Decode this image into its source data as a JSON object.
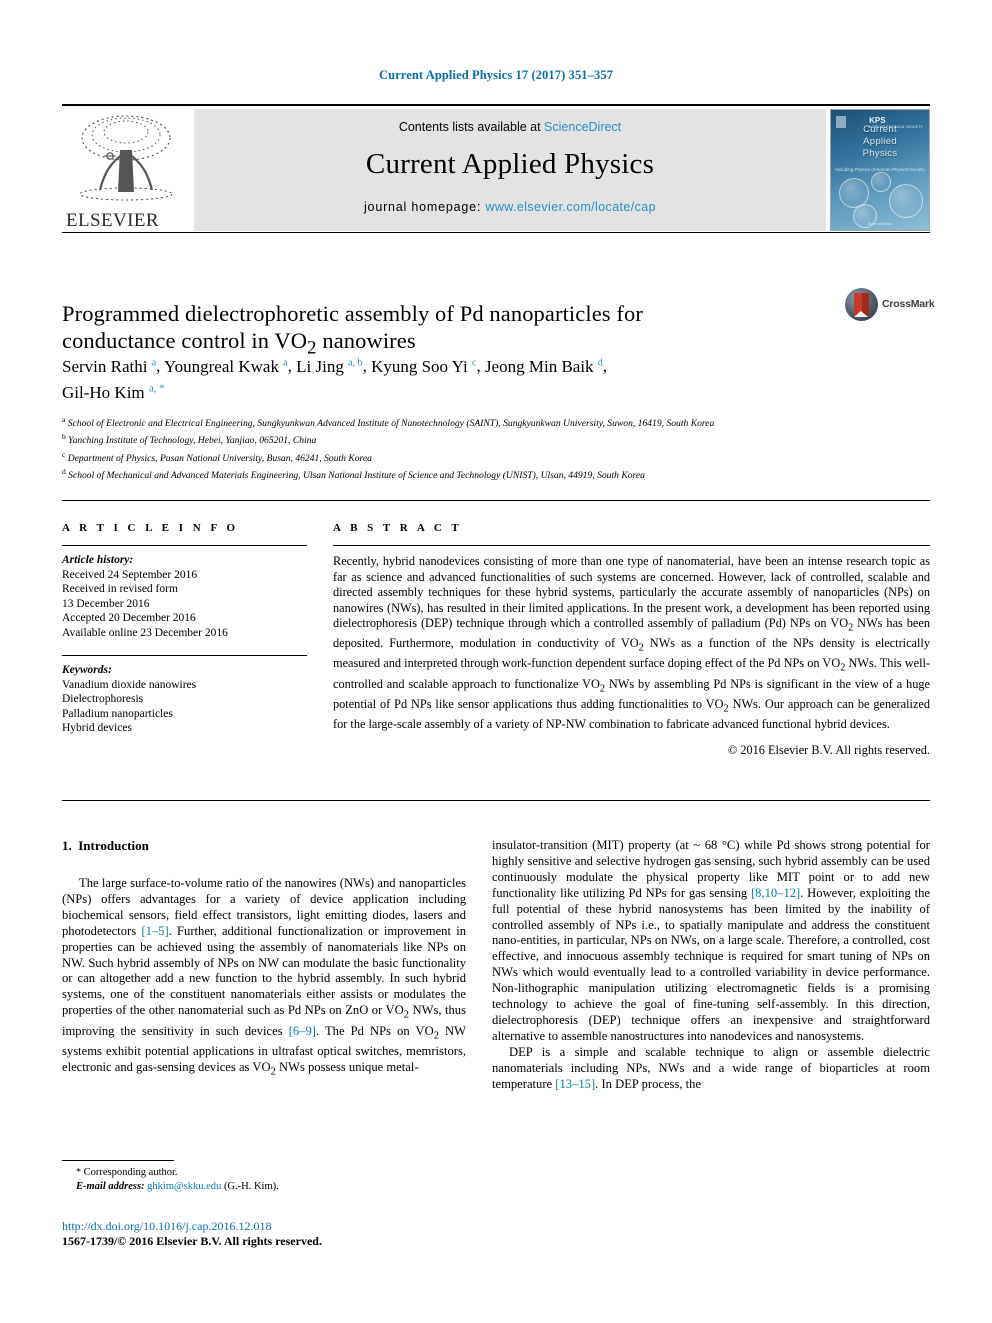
{
  "running_head": "Current Applied Physics 17 (2017) 351–357",
  "masthead": {
    "publisher_name": "ELSEVIER",
    "contents_prefix": "Contents lists available at ",
    "contents_link": "ScienceDirect",
    "journal_name": "Current Applied Physics",
    "homepage_label": "journal homepage: ",
    "homepage_url": "www.elsevier.com/locate/cap",
    "cover": {
      "line1": "Current",
      "line2": "Applied",
      "line3": "Physics",
      "subtitle": "Including Physics of Korean Physical Society",
      "society": "KPS",
      "society_sub": "KOREAN PHYSICAL SOCIETY",
      "footer": "ScienceDirect"
    }
  },
  "article": {
    "title_line1": "Programmed dielectrophoretic assembly of Pd nanoparticles for",
    "title_line2_a": "conductance control in VO",
    "title_line2_sub": "2",
    "title_line2_b": " nanowires",
    "crossmark_label": "CrossMark",
    "authors": [
      {
        "name": "Servin Rathi",
        "marks": "a",
        "sep": ", "
      },
      {
        "name": "Youngreal Kwak",
        "marks": "a",
        "sep": ", "
      },
      {
        "name": "Li Jing",
        "marks": "a, b",
        "sep": ", "
      },
      {
        "name": "Kyung Soo Yi",
        "marks": "c",
        "sep": ", "
      },
      {
        "name": "Jeong Min Baik",
        "marks": "d",
        "sep": ","
      },
      {
        "name": "Gil-Ho Kim",
        "marks": "a, *",
        "sep": ""
      }
    ],
    "affiliations": [
      {
        "mark": "a",
        "text": "School of Electronic and Electrical Engineering, Sungkyunkwan Advanced Institute of Nanotechnology (SAINT), Sungkyunkwan University, Suwon, 16419, South Korea"
      },
      {
        "mark": "b",
        "text": "Yanching Institute of Technology, Hebei, Yanjiao, 065201, China"
      },
      {
        "mark": "c",
        "text": "Department of Physics, Pusan National University, Busan, 46241, South Korea"
      },
      {
        "mark": "d",
        "text": "School of Mechanical and Advanced Materials Engineering, Ulsan National Institute of Science and Technology (UNIST), Ulsan, 44919, South Korea"
      }
    ]
  },
  "article_info": {
    "heading": "A R T I C L E   I N F O",
    "history_label": "Article history:",
    "history": [
      "Received 24 September 2016",
      "Received in revised form",
      "13 December 2016",
      "Accepted 20 December 2016",
      "Available online 23 December 2016"
    ],
    "keywords_label": "Keywords:",
    "keywords": [
      "Vanadium dioxide nanowires",
      "Dielectrophoresis",
      "Palladium nanoparticles",
      "Hybrid devices"
    ]
  },
  "abstract": {
    "heading": "A B S T R A C T",
    "p1": "Recently, hybrid nanodevices consisting of more than one type of nanomaterial, have been an intense research topic as far as science and advanced functionalities of such systems are concerned. However, lack of controlled, scalable and directed assembly techniques for these hybrid systems, particularly the accurate assembly of nanoparticles (NPs) on nanowires (NWs), has resulted in their limited applications. In the present work, a development has been reported using dielectrophoresis (DEP) technique through which a controlled assembly of palladium (Pd) NPs on VO",
    "p1_sub1": "2",
    "p1b": " NWs has been deposited. Furthermore, modulation in conductivity of VO",
    "p1_sub2": "2",
    "p1c": " NWs as a function of the NPs density is electrically measured and interpreted through work-function dependent surface doping effect of the Pd NPs on VO",
    "p1_sub3": "2",
    "p1d": " NWs. This well-controlled and scalable approach to functionalize VO",
    "p1_sub4": "2",
    "p1e": " NWs by assembling Pd NPs is significant in the view of a huge potential of Pd NPs like sensor applications thus adding functionalities to VO",
    "p1_sub5": "2",
    "p1f": " NWs. Our approach can be generalized for the large-scale assembly of a variety of NP-NW combination to fabricate advanced functional hybrid devices.",
    "copyright": "© 2016 Elsevier B.V. All rights reserved."
  },
  "body": {
    "section_number": "1.",
    "section_title": "Introduction",
    "left": {
      "p1_a": "The large surface-to-volume ratio of the nanowires (NWs) and nanoparticles (NPs) offers advantages for a variety of device application including biochemical sensors, field effect transistors, light emitting diodes, lasers and photodetectors ",
      "p1_ref1": "[1–5]",
      "p1_b": ". Further, additional functionalization or improvement in properties can be achieved using the assembly of nanomaterials like NPs on NW. Such hybrid assembly of NPs on NW can modulate the basic functionality or can altogether add a new function to the hybrid assembly. In such hybrid systems, one of the constituent nanomaterials either assists or modulates the properties of the other nanomaterial such as Pd NPs on ZnO or VO",
      "p1_sub1": "2",
      "p1_c": " NWs, thus improving the sensitivity in such devices ",
      "p1_ref2": "[6–9]",
      "p1_d": ". The Pd NPs on VO",
      "p1_sub2": "2",
      "p1_e": " NW systems exhibit potential applications in ultrafast optical switches, memristors, electronic and gas-sensing devices as VO",
      "p1_sub3": "2",
      "p1_f": " NWs possess unique metal-"
    },
    "right": {
      "p1_a": "insulator-transition (MIT) property (at ~ 68 °C) while Pd shows strong potential for highly sensitive and selective hydrogen gas sensing, such hybrid assembly can be used continuously modulate the physical property like MIT point or to add new functionality like utilizing Pd NPs for gas sensing ",
      "p1_ref1": "[8,10–12]",
      "p1_b": ". However, exploiting the full potential of these hybrid nanosystems has been limited by the inability of controlled assembly of NPs i.e., to spatially manipulate and address the constituent nano-entities, in particular, NPs on NWs, on a large scale. Therefore, a controlled, cost effective, and innocuous assembly technique is required for smart tuning of NPs on NWs which would eventually lead to a controlled variability in device performance. Non-lithographic manipulation utilizing electromagnetic fields is a promising technology to achieve the goal of fine-tuning self-assembly. In this direction, dielectrophoresis (DEP) technique offers an inexpensive and straightforward alternative to assemble nanostructures into nanodevices and nanosystems.",
      "p2_a": "DEP is a simple and scalable technique to align or assemble dielectric nanomaterials including NPs, NWs and a wide range of bioparticles at room temperature ",
      "p2_ref1": "[13–15]",
      "p2_b": ". In DEP process, the"
    }
  },
  "footer": {
    "corresponding_star": "*",
    "corresponding_label": "Corresponding author.",
    "email_label": "E-mail address:",
    "email": "ghkim@skku.edu",
    "email_owner": "(G.-H. Kim).",
    "doi": "http://dx.doi.org/10.1016/j.cap.2016.12.018",
    "issn_line": "1567-1739/© 2016 Elsevier B.V. All rights reserved."
  },
  "colors": {
    "link_blue": "#0b7cb0",
    "header_blue": "#0b6ea8",
    "sciencedirect_blue": "#2b8fc4",
    "crossmark_red": "#c63a2b"
  }
}
